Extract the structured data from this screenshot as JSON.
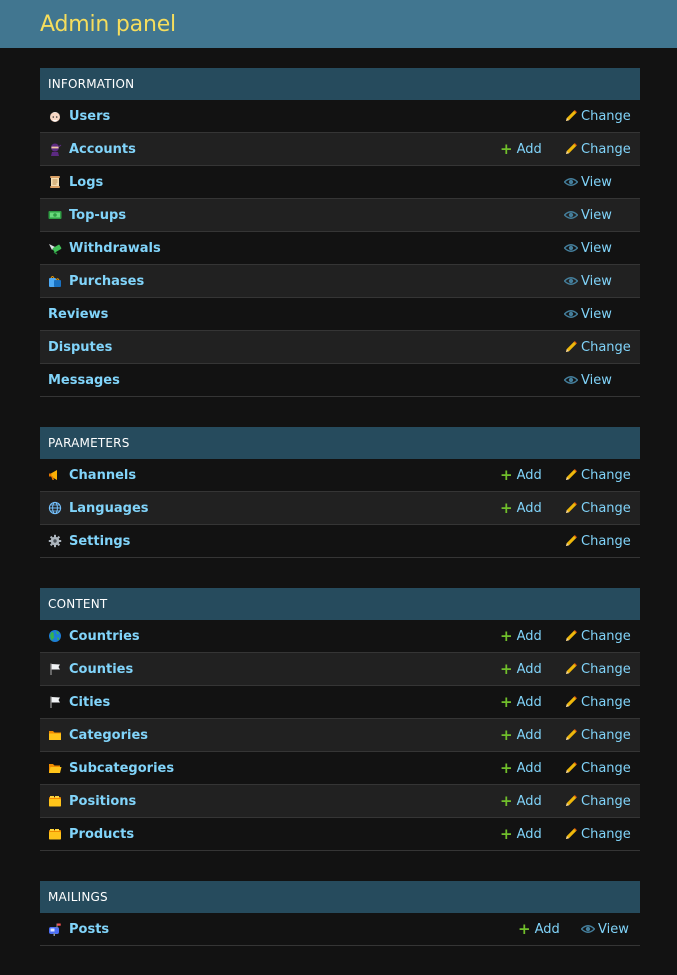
{
  "header": {
    "title": "Admin panel"
  },
  "labels": {
    "add": "Add",
    "change": "Change",
    "view": "View"
  },
  "modules": [
    {
      "caption": "INFORMATION",
      "rows": [
        {
          "name": "Users",
          "icon": "user-emoji-icon",
          "add": false,
          "action": "change"
        },
        {
          "name": "Accounts",
          "icon": "ninja-emoji-icon",
          "add": true,
          "action": "change"
        },
        {
          "name": "Logs",
          "icon": "scroll-emoji-icon",
          "add": false,
          "action": "view"
        },
        {
          "name": "Top-ups",
          "icon": "money-emoji-icon",
          "add": false,
          "action": "view"
        },
        {
          "name": "Withdrawals",
          "icon": "money-wings-emoji-icon",
          "add": false,
          "action": "view"
        },
        {
          "name": "Purchases",
          "icon": "shopping-bags-emoji-icon",
          "add": false,
          "action": "view"
        },
        {
          "name": "Reviews",
          "icon": null,
          "add": false,
          "action": "view"
        },
        {
          "name": "Disputes",
          "icon": null,
          "add": false,
          "action": "change"
        },
        {
          "name": "Messages",
          "icon": null,
          "add": false,
          "action": "view"
        }
      ]
    },
    {
      "caption": "PARAMETERS",
      "rows": [
        {
          "name": "Channels",
          "icon": "megaphone-emoji-icon",
          "add": true,
          "action": "change"
        },
        {
          "name": "Languages",
          "icon": "globe-emoji-icon",
          "add": true,
          "action": "change"
        },
        {
          "name": "Settings",
          "icon": "gear-emoji-icon",
          "add": false,
          "action": "change"
        }
      ]
    },
    {
      "caption": "CONTENT",
      "rows": [
        {
          "name": "Countries",
          "icon": "earth-emoji-icon",
          "add": true,
          "action": "change"
        },
        {
          "name": "Counties",
          "icon": "white-flag-emoji-icon",
          "add": true,
          "action": "change"
        },
        {
          "name": "Cities",
          "icon": "white-flag-emoji-icon",
          "add": true,
          "action": "change"
        },
        {
          "name": "Categories",
          "icon": "folder-emoji-icon",
          "add": true,
          "action": "change"
        },
        {
          "name": "Subcategories",
          "icon": "open-folder-emoji-icon",
          "add": true,
          "action": "change"
        },
        {
          "name": "Positions",
          "icon": "card-index-dividers-emoji-icon",
          "add": true,
          "action": "change"
        },
        {
          "name": "Products",
          "icon": "card-index-dividers-emoji-icon",
          "add": true,
          "action": "change"
        }
      ]
    },
    {
      "caption": "MAILINGS",
      "rows": [
        {
          "name": "Posts",
          "icon": "mailbox-emoji-icon",
          "add": true,
          "action": "view",
          "tight": true
        }
      ]
    }
  ]
}
